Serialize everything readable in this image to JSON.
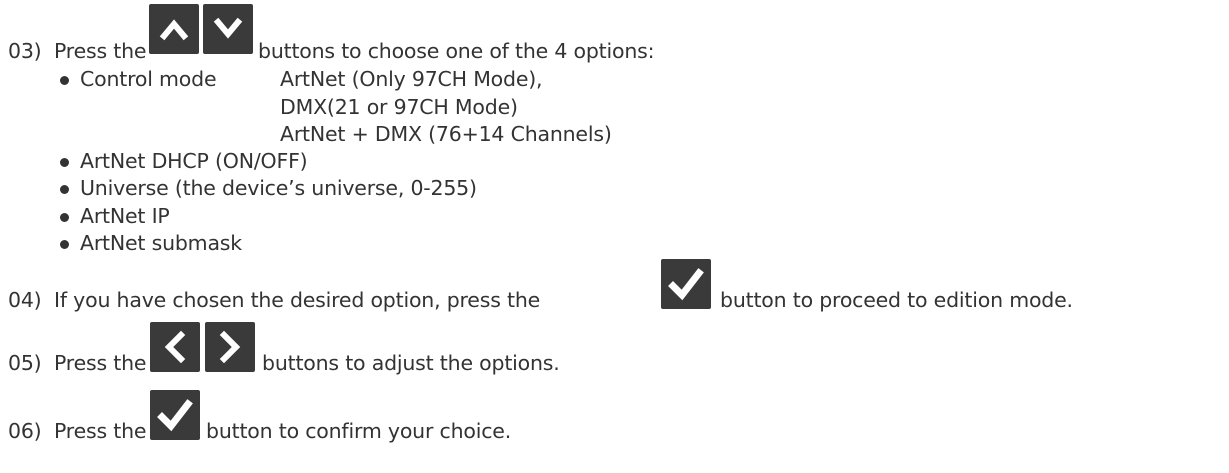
{
  "step03": {
    "num": "03)",
    "press": "Press the",
    "buttons_text": "buttons to choose one of the 4 options:",
    "up_icon": "chevron-up-icon",
    "down_icon": "chevron-down-icon"
  },
  "options": {
    "control_mode": {
      "label": "Control mode",
      "values": [
        "ArtNet (Only 97CH Mode),",
        "DMX(21 or 97CH Mode)",
        "ArtNet + DMX (76+14 Channels)"
      ]
    },
    "items": [
      "ArtNet DHCP (ON/OFF)",
      "Universe (the device’s universe, 0-255)",
      "ArtNet IP",
      "ArtNet submask"
    ]
  },
  "step04": {
    "num": "04)",
    "before": "If you have chosen the desired option, press the",
    "after": "button to proceed to edition mode.",
    "icon": "checkmark-icon"
  },
  "step05": {
    "num": "05)",
    "press": "Press the",
    "after": "buttons to adjust the options.",
    "left_icon": "chevron-left-icon",
    "right_icon": "chevron-right-icon"
  },
  "step06": {
    "num": "06)",
    "press": "Press the",
    "after": "button to confirm your choice.",
    "icon": "checkmark-icon"
  },
  "colors": {
    "text": "#333333",
    "button_bg": "#3a3a3a",
    "glyph": "#ffffff"
  }
}
